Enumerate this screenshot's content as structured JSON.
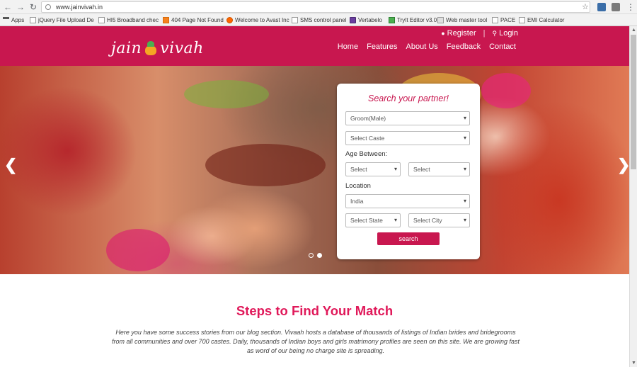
{
  "browser": {
    "url": "www.jainvivah.in",
    "bookmarks": [
      {
        "label": "Apps",
        "icon": "apps-icon"
      },
      {
        "label": "jQuery File Upload De",
        "icon": "page-icon"
      },
      {
        "label": "HI5 Broadband chec",
        "icon": "page-icon"
      },
      {
        "label": "404 Page Not Found",
        "icon": "orange-page-icon"
      },
      {
        "label": "Welcome to Avast Inc",
        "icon": "avast-icon"
      },
      {
        "label": "SMS control panel",
        "icon": "page-icon"
      },
      {
        "label": "Vertabelo",
        "icon": "vertabelo-icon"
      },
      {
        "label": "TryIt Editor v3.0",
        "icon": "tryit-icon"
      },
      {
        "label": "Web master tool",
        "icon": "webmaster-icon"
      },
      {
        "label": "PACE",
        "icon": "page-icon"
      },
      {
        "label": "EMI Calculator",
        "icon": "page-icon"
      }
    ]
  },
  "header": {
    "logo_left": "jain",
    "logo_right": "vivah",
    "register": "Register",
    "login": "Login",
    "separator": "|",
    "nav": [
      "Home",
      "Features",
      "About Us",
      "Feedback",
      "Contact"
    ]
  },
  "search": {
    "title": "Search your partner!",
    "gender": "Groom(Male)",
    "caste": "Select Caste",
    "age_label": "Age Between:",
    "age_from": "Select",
    "age_to": "Select",
    "location_label": "Location",
    "country": "India",
    "state": "Select State",
    "city": "Select City",
    "button": "search"
  },
  "slider": {
    "slides": 2,
    "active": 2
  },
  "content": {
    "title": "Steps to Find Your Match",
    "text": "Here you have some success stories from our blog section. Vivaah hosts a database of thousands of listings of Indian brides and bridegrooms from all communities and over 700 castes. Daily, thousands of Indian boys and girls matrimony profiles are seen on this site. We are growing fast as word of our being no charge site is spreading."
  },
  "colors": {
    "brand": "#c8174f",
    "title": "#e0195a"
  }
}
